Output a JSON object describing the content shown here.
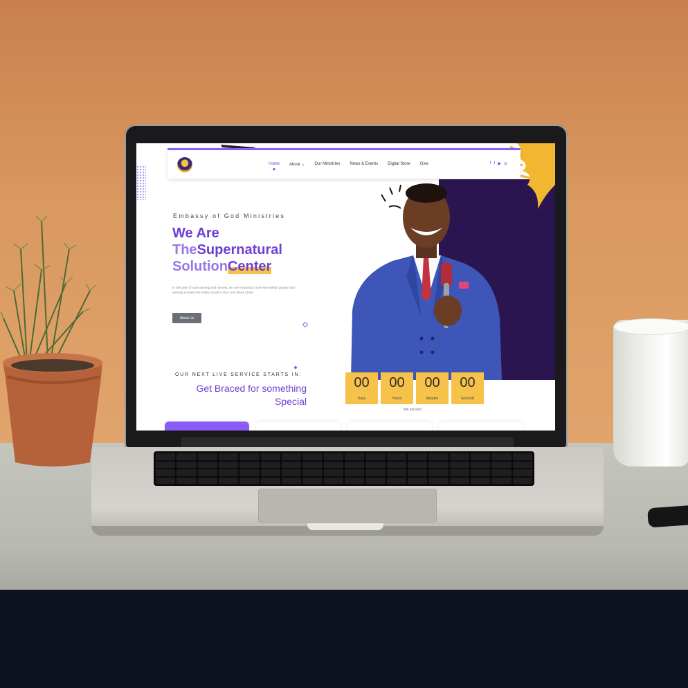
{
  "site": {
    "nav": {
      "items": [
        {
          "label": "Home",
          "active": true
        },
        {
          "label": "About ⌄",
          "active": false
        },
        {
          "label": "Our Ministries",
          "active": false
        },
        {
          "label": "News & Events",
          "active": false
        },
        {
          "label": "Digital Store",
          "active": false
        },
        {
          "label": "Give",
          "active": false
        }
      ],
      "social": [
        "f",
        "t",
        "▶",
        "◎"
      ]
    },
    "hero": {
      "eyebrow": "Embassy of God Ministries",
      "title_line1": "We Are",
      "title_line2a": "The",
      "title_line2b": "Supernatural",
      "title_line3a": "Solution",
      "title_line3b": "Center",
      "paragraph": "In this year of soul winning and harvest, we are reaching to over five million people and winning at least one million souls to the Lord Jesus Christ",
      "button_label": "About Us"
    },
    "service": {
      "eyebrow": "OUR NEXT LIVE SERVICE STARTS IN:",
      "heading_line1": "Get Braced for something",
      "heading_line2": "Special",
      "countdown": [
        {
          "value": "00",
          "label": "Days"
        },
        {
          "value": "00",
          "label": "Hours"
        },
        {
          "value": "00",
          "label": "Minutes"
        },
        {
          "value": "00",
          "label": "Seconds"
        }
      ],
      "live_note": "We are live!"
    },
    "colors": {
      "primary": "#6d3fd3",
      "accent": "#f6c24a",
      "dark_panel": "#2a1550"
    }
  }
}
